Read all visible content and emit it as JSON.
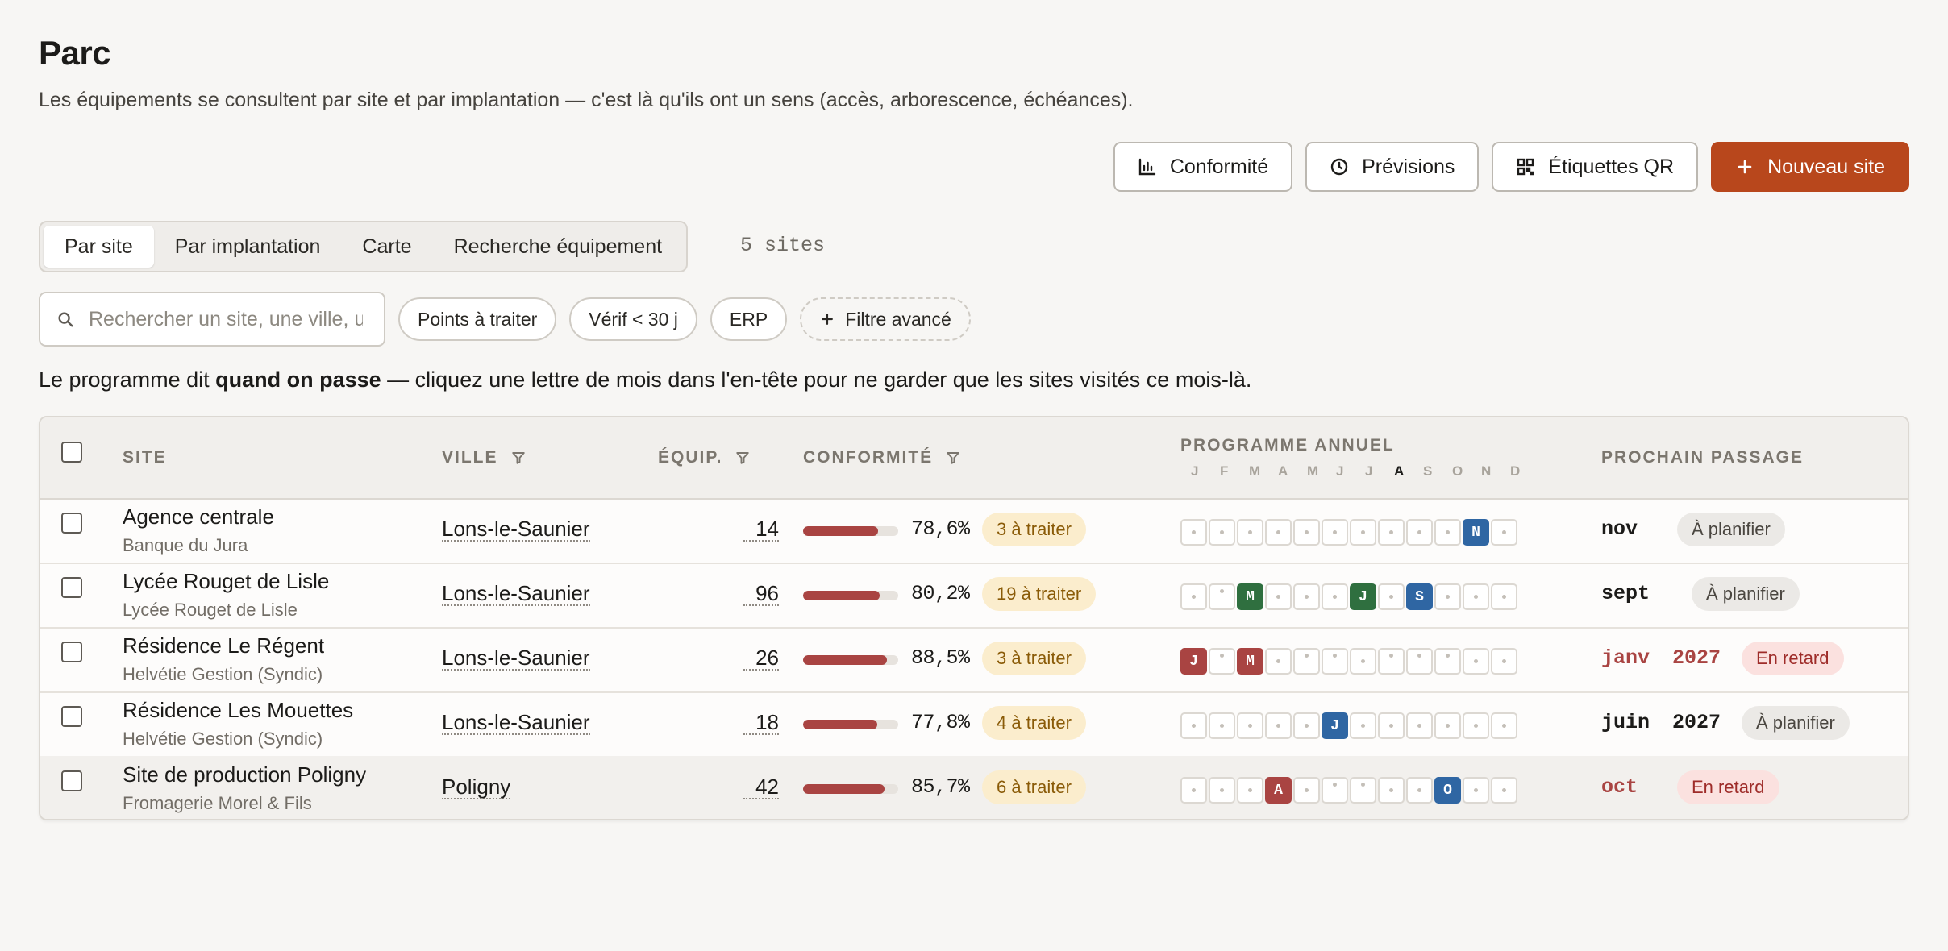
{
  "page": {
    "title": "Parc",
    "subtitle": "Les équipements se consultent par site et par implantation — c'est là qu'ils ont un sens (accès, arborescence, échéances)."
  },
  "actions": {
    "conformite": {
      "label": "Conformité",
      "icon": "bar-chart-icon"
    },
    "previsions": {
      "label": "Prévisions",
      "icon": "clock-icon"
    },
    "etiquettes": {
      "label": "Étiquettes QR",
      "icon": "qr-code-icon"
    },
    "nouveau": {
      "label": "Nouveau site",
      "icon": "plus-icon"
    }
  },
  "tabs": [
    {
      "label": "Par site",
      "active": true
    },
    {
      "label": "Par implantation",
      "active": false
    },
    {
      "label": "Carte",
      "active": false
    },
    {
      "label": "Recherche équipement",
      "active": false
    }
  ],
  "site_count": "5 sites",
  "search": {
    "placeholder": "Rechercher un site, une ville, un client…",
    "value": ""
  },
  "chips": [
    {
      "label": "Points à traiter"
    },
    {
      "label": "Vérif < 30 j"
    },
    {
      "label": "ERP"
    }
  ],
  "advanced_filter": "Filtre avancé",
  "hint": {
    "before": "Le programme dit ",
    "bold": "quand on passe",
    "after": " — cliquez une lettre de mois dans l'en-tête pour ne garder que les sites visités ce mois-là."
  },
  "table": {
    "headers": {
      "site": "SITE",
      "ville": "VILLE",
      "equip": "ÉQUIP.",
      "conformite": "CONFORMITÉ",
      "programme": "PROGRAMME ANNUEL",
      "prochain": "PROCHAIN PASSAGE"
    },
    "months": [
      "J",
      "F",
      "M",
      "A",
      "M",
      "J",
      "J",
      "A",
      "S",
      "O",
      "N",
      "D"
    ],
    "current_month_index": 7,
    "colors": {
      "red": "#a94442",
      "green": "#2f6f3f",
      "blue": "#2f66a3",
      "accent": "#b8471c"
    },
    "rows": [
      {
        "name": "Agence centrale",
        "client": "Banque du Jura",
        "ville": "Lons-le-Saunier",
        "equip": "14",
        "conformity": 0.786,
        "pct": "78,6%",
        "badge": "3 à traiter",
        "program": [
          {
            "t": "dot"
          },
          {
            "t": "dot"
          },
          {
            "t": "dot"
          },
          {
            "t": "dot"
          },
          {
            "t": "dot"
          },
          {
            "t": "dot"
          },
          {
            "t": "dot"
          },
          {
            "t": "dot"
          },
          {
            "t": "dot"
          },
          {
            "t": "dot"
          },
          {
            "t": "blue",
            "l": "N"
          },
          {
            "t": "dot"
          }
        ],
        "next_month": "nov",
        "next_year": "",
        "next_late": false,
        "status": "À planifier",
        "status_type": "plan"
      },
      {
        "name": "Lycée Rouget de Lisle",
        "client": "Lycée Rouget de Lisle",
        "ville": "Lons-le-Saunier",
        "equip": "96",
        "conformity": 0.802,
        "pct": "80,2%",
        "badge": "19 à traiter",
        "program": [
          {
            "t": "dot"
          },
          {
            "t": "top"
          },
          {
            "t": "green",
            "l": "M"
          },
          {
            "t": "dot"
          },
          {
            "t": "dot"
          },
          {
            "t": "dot"
          },
          {
            "t": "green",
            "l": "J"
          },
          {
            "t": "dot"
          },
          {
            "t": "blue",
            "l": "S"
          },
          {
            "t": "dot"
          },
          {
            "t": "dot"
          },
          {
            "t": "dot"
          }
        ],
        "next_month": "sept",
        "next_year": "",
        "next_late": false,
        "status": "À planifier",
        "status_type": "plan"
      },
      {
        "name": "Résidence Le Régent",
        "client": "Helvétie Gestion (Syndic)",
        "ville": "Lons-le-Saunier",
        "equip": "26",
        "conformity": 0.885,
        "pct": "88,5%",
        "badge": "3 à traiter",
        "program": [
          {
            "t": "red",
            "l": "J"
          },
          {
            "t": "top"
          },
          {
            "t": "red",
            "l": "M"
          },
          {
            "t": "dot"
          },
          {
            "t": "top"
          },
          {
            "t": "top"
          },
          {
            "t": "dot"
          },
          {
            "t": "top"
          },
          {
            "t": "top"
          },
          {
            "t": "top"
          },
          {
            "t": "dot"
          },
          {
            "t": "dot"
          }
        ],
        "next_month": "janv",
        "next_year": "2027",
        "next_late": true,
        "status": "En retard",
        "status_type": "late"
      },
      {
        "name": "Résidence Les Mouettes",
        "client": "Helvétie Gestion (Syndic)",
        "ville": "Lons-le-Saunier",
        "equip": "18",
        "conformity": 0.778,
        "pct": "77,8%",
        "badge": "4 à traiter",
        "program": [
          {
            "t": "dot"
          },
          {
            "t": "dot"
          },
          {
            "t": "dot"
          },
          {
            "t": "dot"
          },
          {
            "t": "dot"
          },
          {
            "t": "blue",
            "l": "J"
          },
          {
            "t": "dot"
          },
          {
            "t": "dot"
          },
          {
            "t": "dot"
          },
          {
            "t": "dot"
          },
          {
            "t": "dot"
          },
          {
            "t": "dot"
          }
        ],
        "next_month": "juin",
        "next_year": "2027",
        "next_late": false,
        "status": "À planifier",
        "status_type": "plan"
      },
      {
        "name": "Site de production Poligny",
        "client": "Fromagerie Morel & Fils",
        "ville": "Poligny",
        "equip": "42",
        "conformity": 0.857,
        "pct": "85,7%",
        "badge": "6 à traiter",
        "program": [
          {
            "t": "dot"
          },
          {
            "t": "dot"
          },
          {
            "t": "dot"
          },
          {
            "t": "red",
            "l": "A"
          },
          {
            "t": "dot"
          },
          {
            "t": "top"
          },
          {
            "t": "top"
          },
          {
            "t": "dot"
          },
          {
            "t": "dot"
          },
          {
            "t": "blue",
            "l": "O"
          },
          {
            "t": "dot"
          },
          {
            "t": "dot"
          }
        ],
        "next_month": "oct",
        "next_year": "",
        "next_late": true,
        "status": "En retard",
        "status_type": "late"
      }
    ]
  }
}
